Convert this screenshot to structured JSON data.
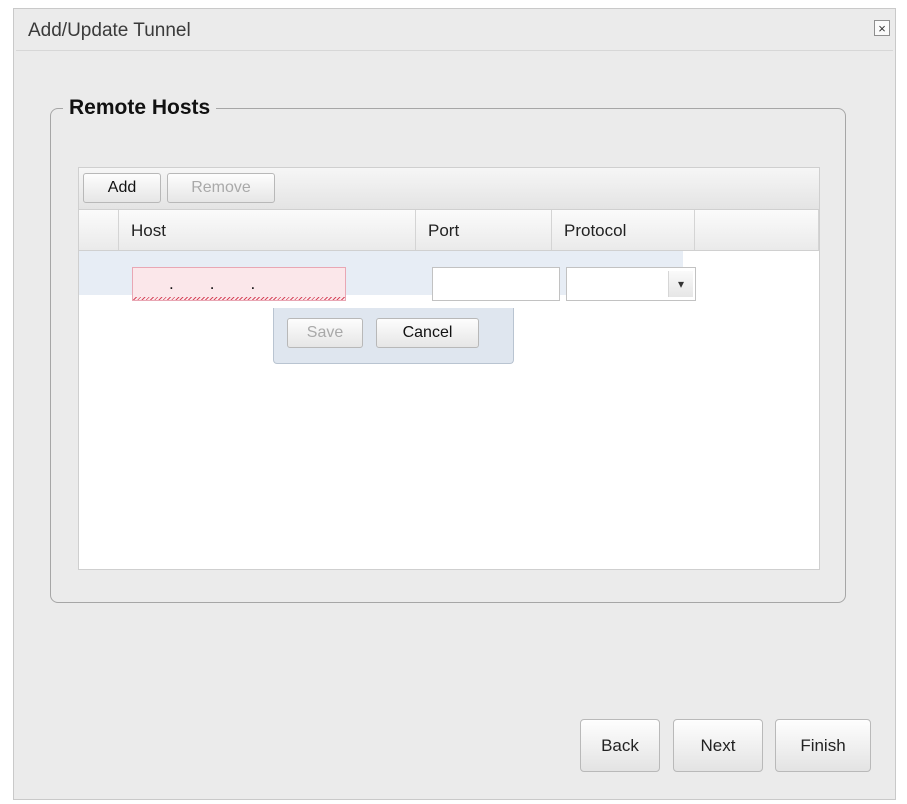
{
  "window": {
    "title": "Add/Update Tunnel",
    "close_symbol": "×"
  },
  "section": {
    "legend": "Remote Hosts"
  },
  "grid": {
    "toolbar": {
      "add_label": "Add",
      "remove_label": "Remove"
    },
    "columns": [
      "Host",
      "Port",
      "Protocol"
    ],
    "editor": {
      "host_value": "...",
      "port_value": "",
      "protocol_value": "",
      "trigger_symbol": "▾",
      "save_label": "Save",
      "cancel_label": "Cancel"
    }
  },
  "footer": {
    "back_label": "Back",
    "next_label": "Next",
    "finish_label": "Finish"
  }
}
